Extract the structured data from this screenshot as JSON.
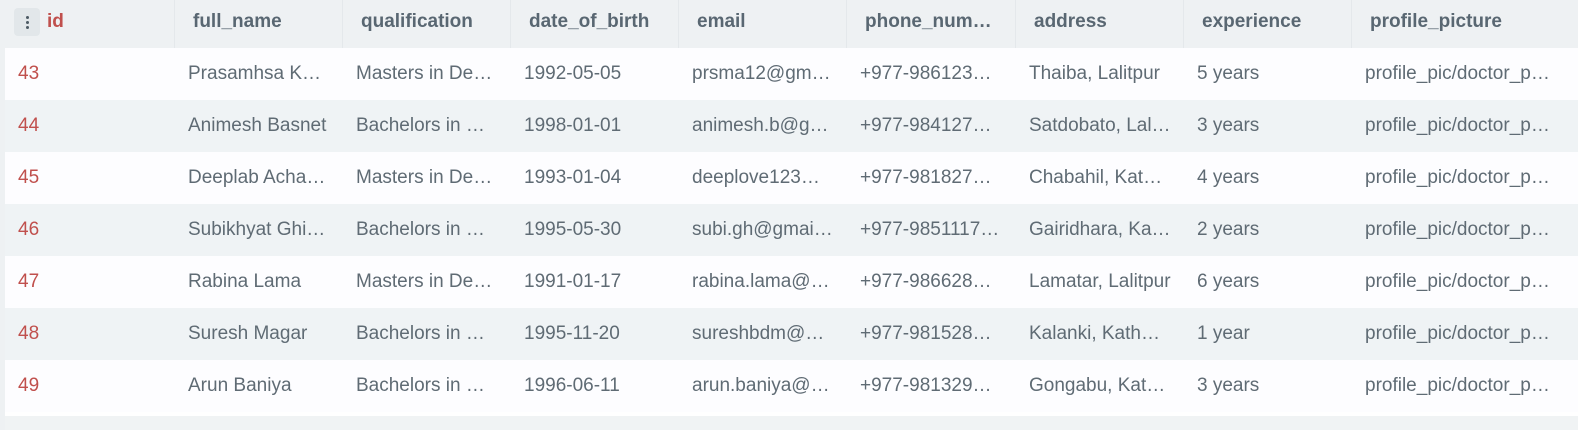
{
  "table": {
    "columns": [
      {
        "key": "id",
        "label": "id"
      },
      {
        "key": "full_name",
        "label": "full_name"
      },
      {
        "key": "qualification",
        "label": "qualification"
      },
      {
        "key": "date_of_birth",
        "label": "date_of_birth"
      },
      {
        "key": "email",
        "label": "email"
      },
      {
        "key": "phone_number",
        "label": "phone_num…"
      },
      {
        "key": "address",
        "label": "address"
      },
      {
        "key": "experience",
        "label": "experience"
      },
      {
        "key": "profile_picture",
        "label": "profile_picture"
      }
    ],
    "rows": [
      {
        "id": "43",
        "full_name": "Prasamhsa K…",
        "qualification": "Masters in De…",
        "date_of_birth": "1992-05-05",
        "email": "prsma12@gm…",
        "phone_number": "+977-986123…",
        "address": "Thaiba, Lalitpur",
        "experience": "5 years",
        "profile_picture": "profile_pic/doctor_pr…"
      },
      {
        "id": "44",
        "full_name": "Animesh Basnet",
        "qualification": "Bachelors in …",
        "date_of_birth": "1998-01-01",
        "email": "animesh.b@g…",
        "phone_number": "+977-984127…",
        "address": "Satdobato, Lal…",
        "experience": "3 years",
        "profile_picture": "profile_pic/doctor_pr…"
      },
      {
        "id": "45",
        "full_name": "Deeplab Acha…",
        "qualification": "Masters in De…",
        "date_of_birth": "1993-01-04",
        "email": "deeplove123…",
        "phone_number": "+977-981827…",
        "address": "Chabahil, Kat…",
        "experience": "4 years",
        "profile_picture": "profile_pic/doctor_pr…"
      },
      {
        "id": "46",
        "full_name": "Subikhyat Ghi…",
        "qualification": "Bachelors in …",
        "date_of_birth": "1995-05-30",
        "email": "subi.gh@gmai…",
        "phone_number": "+977-9851117…",
        "address": "Gairidhara, Ka…",
        "experience": "2 years",
        "profile_picture": "profile_pic/doctor_pr…"
      },
      {
        "id": "47",
        "full_name": "Rabina Lama",
        "qualification": "Masters in De…",
        "date_of_birth": "1991-01-17",
        "email": "rabina.lama@…",
        "phone_number": "+977-986628…",
        "address": "Lamatar, Lalitpur",
        "experience": "6 years",
        "profile_picture": "profile_pic/doctor_pr…"
      },
      {
        "id": "48",
        "full_name": "Suresh Magar",
        "qualification": "Bachelors in …",
        "date_of_birth": "1995-11-20",
        "email": "sureshbdm@…",
        "phone_number": "+977-981528…",
        "address": "Kalanki, Kath…",
        "experience": "1 year",
        "profile_picture": "profile_pic/doctor_pr…"
      },
      {
        "id": "49",
        "full_name": "Arun Baniya",
        "qualification": "Bachelors in …",
        "date_of_birth": "1996-06-11",
        "email": "arun.baniya@…",
        "phone_number": "+977-981329…",
        "address": "Gongabu, Kat…",
        "experience": "3 years",
        "profile_picture": "profile_pic/doctor_pr…"
      }
    ]
  },
  "icons": {
    "column_menu": "kebab-menu-icon"
  },
  "colors": {
    "id_text": "#c0504d",
    "header_bg": "#eef1f3",
    "row_alt_bg": "#eff3f5"
  }
}
